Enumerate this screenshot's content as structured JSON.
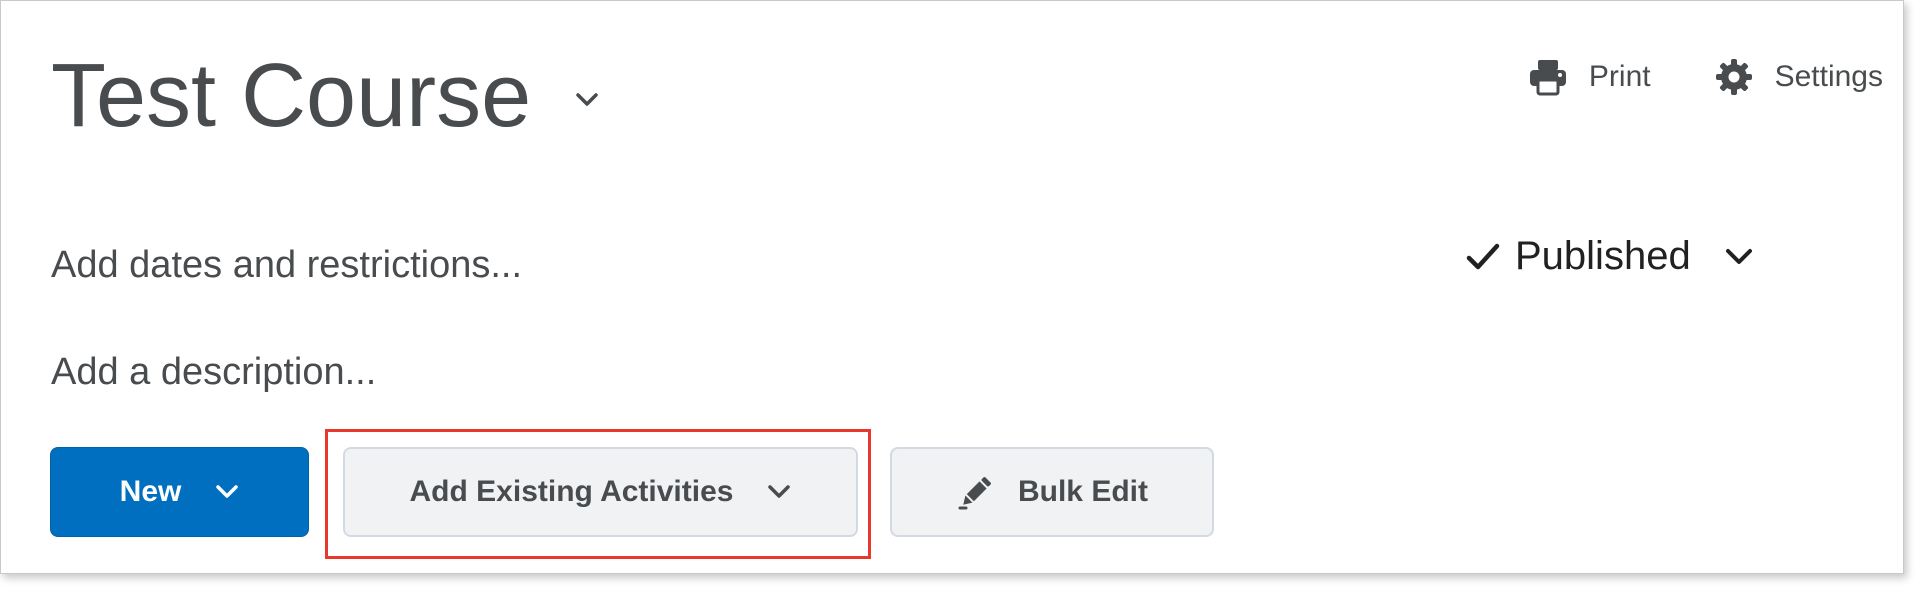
{
  "course": {
    "title": "Test Course"
  },
  "top_actions": {
    "print_label": "Print",
    "settings_label": "Settings"
  },
  "details": {
    "dates_text": "Add dates and restrictions...",
    "description_text": "Add a description..."
  },
  "status": {
    "published_label": "Published"
  },
  "toolbar": {
    "new_label": "New",
    "add_existing_label": "Add Existing Activities",
    "bulk_edit_label": "Bulk Edit"
  },
  "colors": {
    "primary_button": "#006fbf",
    "highlight": "#e8382d",
    "text": "#494c4e"
  },
  "icons": {
    "print": "printer-icon",
    "settings": "gear-icon",
    "published": "checkmark-icon",
    "bulk_edit": "pencil-icon",
    "dropdown": "chevron-down-icon"
  }
}
